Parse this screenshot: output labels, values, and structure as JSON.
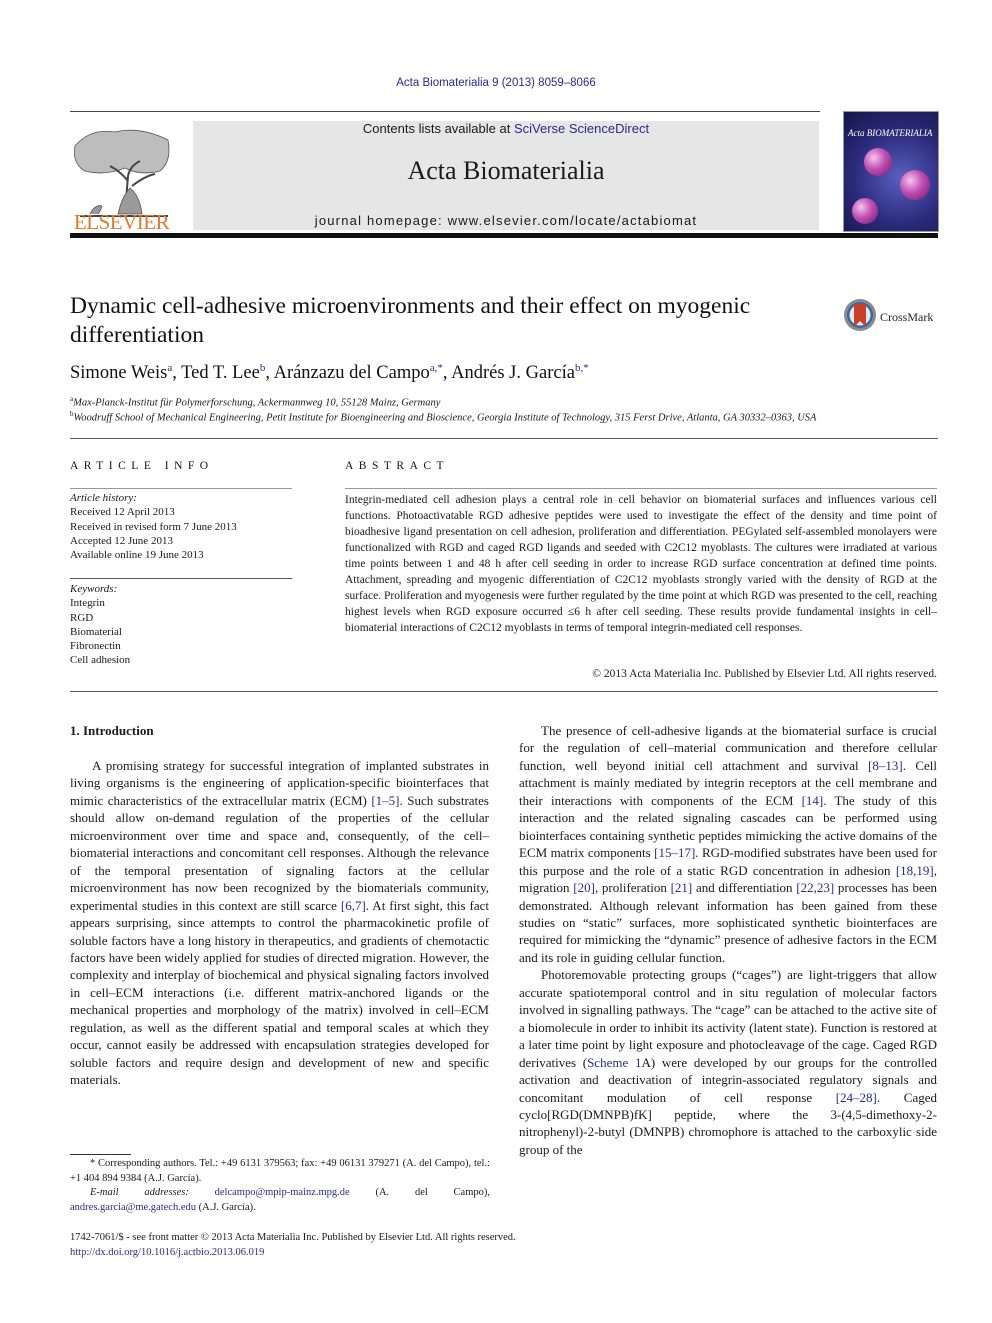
{
  "header": {
    "running_head": "Acta Biomaterialia 9 (2013) 8059–8066",
    "publisher_logo_text": "ELSEVIER",
    "contents_prefix": "Contents lists available at ",
    "contents_link": "SciVerse ScienceDirect",
    "journal_name": "Acta Biomaterialia",
    "homepage_label": "journal homepage: www.elsevier.com/locate/actabiomat",
    "cover_title": "Acta BIOMATERIALIA",
    "brand_color": "#e6792b",
    "link_color": "#2a2a8c"
  },
  "article": {
    "title": "Dynamic cell-adhesive microenvironments and their effect on myogenic differentiation",
    "crossmark_label": "CrossMark",
    "authors": [
      {
        "name": "Simone Weis",
        "sup": "a"
      },
      {
        "name": "Ted T. Lee",
        "sup": "b"
      },
      {
        "name": "Aránzazu del Campo",
        "sup": "a,*"
      },
      {
        "name": "Andrés J. García",
        "sup": "b,*"
      }
    ],
    "affiliations": [
      {
        "mark": "a",
        "text": "Max-Planck-Institut für Polymerforschung, Ackermannweg 10, 55128 Mainz, Germany"
      },
      {
        "mark": "b",
        "text": "Woodruff School of Mechanical Engineering, Petit Institute for Bioengineering and Bioscience, Georgia Institute of Technology, 315 Ferst Drive, Atlanta, GA 30332–0363, USA"
      }
    ]
  },
  "article_info": {
    "heading": "ARTICLE INFO",
    "history_label": "Article history:",
    "history": [
      "Received 12 April 2013",
      "Received in revised form 7 June 2013",
      "Accepted 12 June 2013",
      "Available online 19 June 2013"
    ],
    "keywords_label": "Keywords:",
    "keywords": [
      "Integrin",
      "RGD",
      "Biomaterial",
      "Fibronectin",
      "Cell adhesion"
    ]
  },
  "abstract": {
    "heading": "ABSTRACT",
    "text": "Integrin-mediated cell adhesion plays a central role in cell behavior on biomaterial surfaces and influences various cell functions. Photoactivatable RGD adhesive peptides were used to investigate the effect of the density and time point of bioadhesive ligand presentation on cell adhesion, proliferation and differentiation. PEGylated self-assembled monolayers were functionalized with RGD and caged RGD ligands and seeded with C2C12 myoblasts. The cultures were irradiated at various time points between 1 and 48 h after cell seeding in order to increase RGD surface concentration at defined time points. Attachment, spreading and myogenic differentiation of C2C12 myoblasts strongly varied with the density of RGD at the surface. Proliferation and myogenesis were further regulated by the time point at which RGD was presented to the cell, reaching highest levels when RGD exposure occurred ≤6 h after cell seeding. These results provide fundamental insights in cell–biomaterial interactions of C2C12 myoblasts in terms of temporal integrin-mediated cell responses.",
    "copyright": "© 2013 Acta Materialia Inc. Published by Elsevier Ltd. All rights reserved."
  },
  "body": {
    "section_title": "1. Introduction",
    "left_para": [
      {
        "t": "A promising strategy for successful integration of implanted substrates in living organisms is the engineering of application-specific biointerfaces that mimic characteristics of the extracellular matrix (ECM) "
      },
      {
        "ref": "[1–5]"
      },
      {
        "t": ". Such substrates should allow on-demand regulation of the properties of the cellular microenvironment over time and space and, consequently, of the cell–biomaterial interactions and concomitant cell responses. Although the relevance of the temporal presentation of signaling factors at the cellular microenvironment has now been recognized by the biomaterials community, experimental studies in this context are still scarce "
      },
      {
        "ref": "[6,7]"
      },
      {
        "t": ". At first sight, this fact appears surprising, since attempts to control the pharmacokinetic profile of soluble factors have a long history in therapeutics, and gradients of chemotactic factors have been widely applied for studies of directed migration. However, the complexity and interplay of biochemical and physical signaling factors involved in cell–ECM interactions (i.e. different matrix-anchored ligands or the mechanical properties and morphology of the matrix) involved in cell–ECM regulation, as well as the different spatial and temporal scales at which they occur, cannot easily be addressed with encapsulation strategies developed for soluble factors and require design and development of new and specific materials."
      }
    ],
    "right_para1": [
      {
        "t": "The presence of cell-adhesive ligands at the biomaterial surface is crucial for the regulation of cell–material communication and therefore cellular function, well beyond initial cell attachment and survival "
      },
      {
        "ref": "[8–13]"
      },
      {
        "t": ". Cell attachment is mainly mediated by integrin receptors at the cell membrane and their interactions with components of the ECM "
      },
      {
        "ref": "[14]"
      },
      {
        "t": ". The study of this interaction and the related signaling cascades can be performed using biointerfaces containing synthetic peptides mimicking the active domains of the ECM matrix components "
      },
      {
        "ref": "[15–17]"
      },
      {
        "t": ". RGD-modified substrates have been used for this purpose and the role of a static RGD concentration in adhesion "
      },
      {
        "ref": "[18,19]"
      },
      {
        "t": ", migration "
      },
      {
        "ref": "[20]"
      },
      {
        "t": ", proliferation "
      },
      {
        "ref": "[21]"
      },
      {
        "t": " and differentiation "
      },
      {
        "ref": "[22,23]"
      },
      {
        "t": " processes has been demonstrated. Although relevant information has been gained from these studies on “static” surfaces, more sophisticated synthetic biointerfaces are required for mimicking the “dynamic” presence of adhesive factors in the ECM and its role in guiding cellular function."
      }
    ],
    "right_para2": [
      {
        "t": "Photoremovable protecting groups (“cages”) are light-triggers that allow accurate spatiotemporal control and in situ regulation of molecular factors involved in signalling pathways. The “cage” can be attached to the active site of a biomolecule in order to inhibit its activity (latent state). Function is restored at a later time point by light exposure and photocleavage of the cage. Caged RGD derivatives ("
      },
      {
        "ref": "Scheme 1"
      },
      {
        "t": "A) were developed by our groups for the controlled activation and deactivation of integrin-associated regulatory signals and concomitant modulation of cell response "
      },
      {
        "ref": "[24–28]"
      },
      {
        "t": ". Caged cyclo[RGD(DMNPB)fK] peptide, where the 3-(4,5-dimethoxy-2-nitrophenyl)-2-butyl (DMNPB) chromophore is attached to the carboxylic side group of the"
      }
    ]
  },
  "footnotes": {
    "corresponding": "* Corresponding authors. Tel.: +49 6131 379563; fax: +49 06131 379271 (A. del Campo), tel.: +1 404 894 9384 (A.J. García).",
    "email_label": "E-mail addresses: ",
    "email1": "delcampo@mpip-mainz.mpg.de",
    "email1_owner": " (A. del Campo), ",
    "email2": "andres.garcia@me.gatech.edu",
    "email2_owner": " (A.J. García).",
    "issn_line": "1742-7061/$ - see front matter © 2013 Acta Materialia Inc. Published by Elsevier Ltd. All rights reserved.",
    "doi": "http://dx.doi.org/10.1016/j.actbio.2013.06.019"
  }
}
